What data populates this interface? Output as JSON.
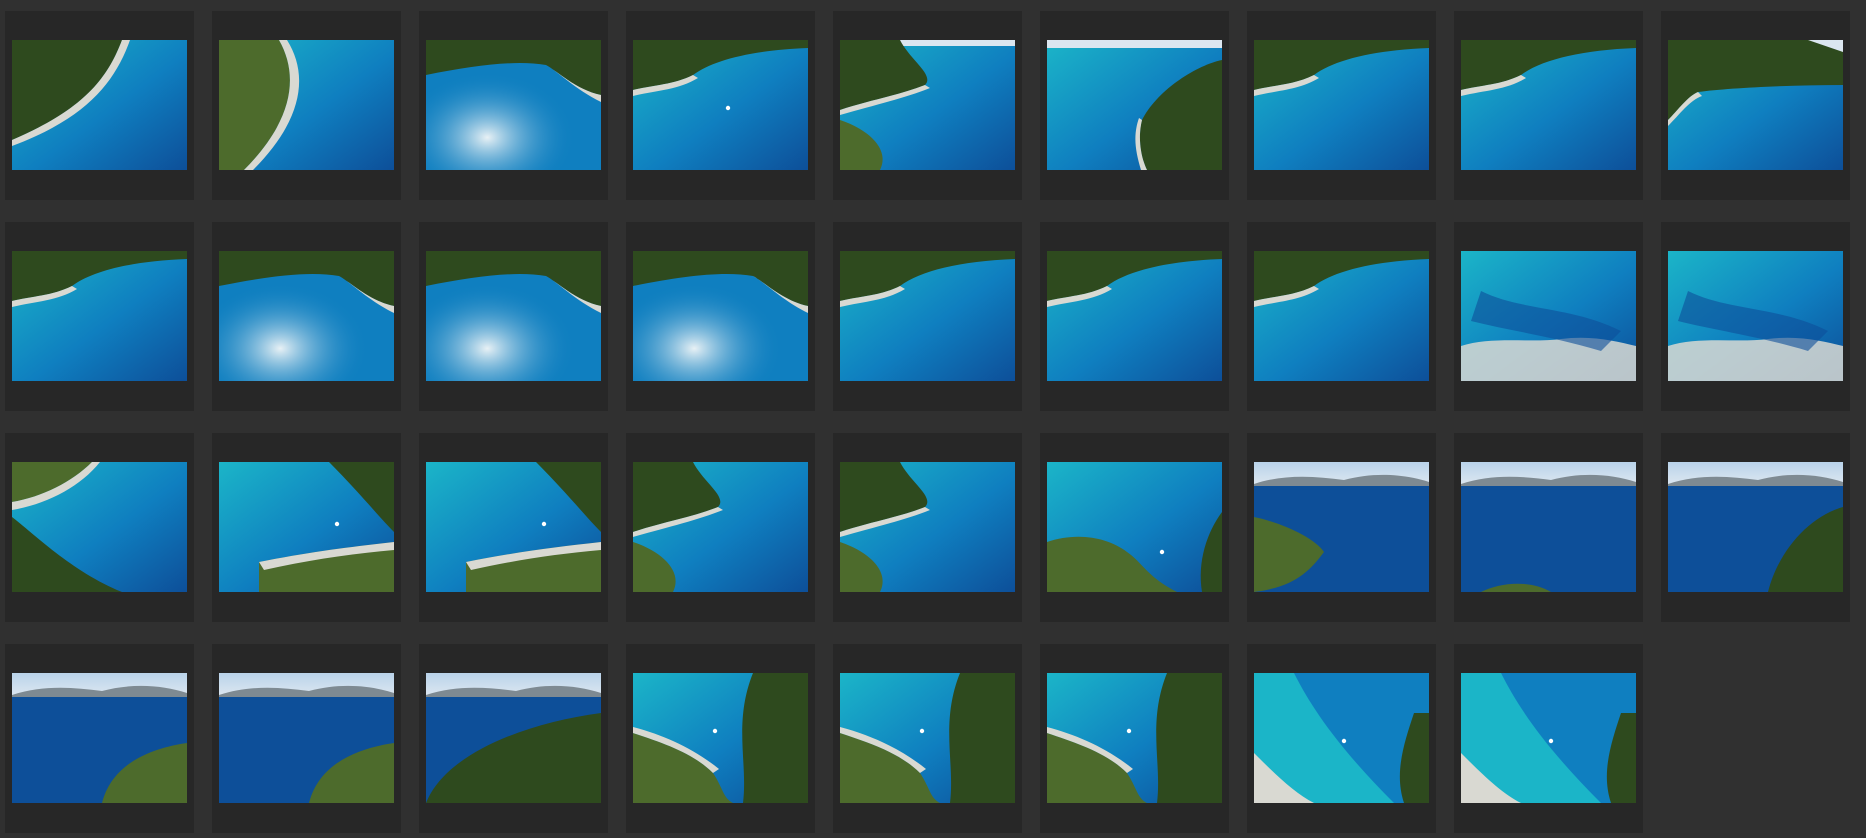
{
  "browser": {
    "columns": 9
  },
  "thumbnails": [
    {
      "scene": "coast-diag"
    },
    {
      "scene": "coast-curve"
    },
    {
      "scene": "cove-sun"
    },
    {
      "scene": "bay-top-boat"
    },
    {
      "scene": "headland-left-sky"
    },
    {
      "scene": "island-right-sky"
    },
    {
      "scene": "bay-top"
    },
    {
      "scene": "bay-top"
    },
    {
      "scene": "bay-top-sky"
    },
    {
      "scene": "bay-top"
    },
    {
      "scene": "cove-sun"
    },
    {
      "scene": "cove-sun"
    },
    {
      "scene": "cove-sun"
    },
    {
      "scene": "bay-top"
    },
    {
      "scene": "bay-top"
    },
    {
      "scene": "bay-top"
    },
    {
      "scene": "rocks-bottom"
    },
    {
      "scene": "rocks-bottom"
    },
    {
      "scene": "bay-diag-forest"
    },
    {
      "scene": "bay-rocks-boat"
    },
    {
      "scene": "bay-rocks-boat"
    },
    {
      "scene": "headland-left"
    },
    {
      "scene": "headland-left"
    },
    {
      "scene": "peninsula-boat"
    },
    {
      "scene": "horizon-shore"
    },
    {
      "scene": "horizon-open"
    },
    {
      "scene": "horizon-island-right"
    },
    {
      "scene": "horizon-island"
    },
    {
      "scene": "horizon-island"
    },
    {
      "scene": "horizon-island-big"
    },
    {
      "scene": "cove-right-forest"
    },
    {
      "scene": "cove-right-forest"
    },
    {
      "scene": "cove-right-forest"
    },
    {
      "scene": "shallow-boat"
    },
    {
      "scene": "shallow-boat"
    }
  ],
  "palette": {
    "deep": "#0d4f99",
    "mid": "#0f7fc0",
    "turquoise": "#1bb5c8",
    "shallow": "#7fd9d6",
    "forest": "#2e4a1e",
    "forestLight": "#4d6b2c",
    "rock": "#d9d9d2",
    "sky": "#dbe6f0",
    "hills": "#7e8a92"
  }
}
